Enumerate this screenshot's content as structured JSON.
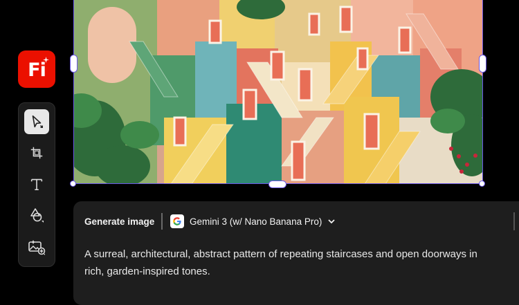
{
  "app": {
    "logo_text": "Fi",
    "brand_color": "#eb1000"
  },
  "toolbar": {
    "tools": [
      {
        "name": "select-tool",
        "icon": "pointer-icon",
        "active": true
      },
      {
        "name": "frame-tool",
        "icon": "crop-frame-icon",
        "active": false
      },
      {
        "name": "text-tool",
        "icon": "text-icon",
        "active": false
      },
      {
        "name": "shape-tool",
        "icon": "shapes-icon",
        "active": false
      },
      {
        "name": "generate-image-tool",
        "icon": "image-add-icon",
        "active": false
      }
    ]
  },
  "canvas": {
    "selection_color": "#6b57e8"
  },
  "generate_panel": {
    "label": "Generate image",
    "model": "Gemini 3 (w/ Nano Banana Pro)",
    "prompt": "A surreal, architectural, abstract pattern of repeating staircases and open doorways in rich, garden-inspired tones."
  }
}
